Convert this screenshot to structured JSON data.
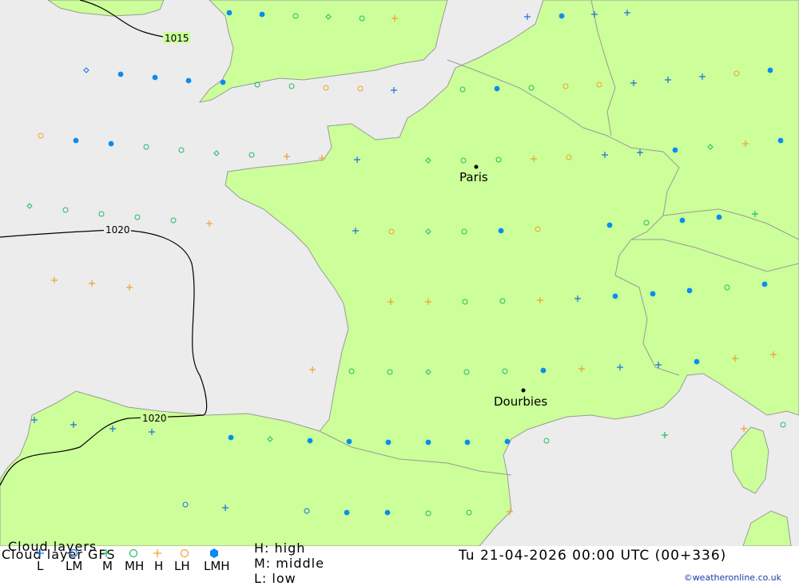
{
  "colors": {
    "sea": "#ececec",
    "land": "#ccff99",
    "border": "#9a9a9a",
    "isobar": "#000000",
    "low": "#1a6fe0",
    "middle": "#22bb66",
    "high": "#f0a030",
    "lmh": "#0a8cf0"
  },
  "isobars": [
    {
      "label": "1015"
    },
    {
      "label": "1020"
    },
    {
      "label": "1020"
    }
  ],
  "cities": [
    {
      "name": "Paris"
    },
    {
      "name": "Dourbies"
    }
  ],
  "footer": {
    "title_top": "Cloud layers",
    "title": "Cloud layer   GFS",
    "legend": [
      {
        "label": "L",
        "icon": "plus",
        "color": "#1a6fe0"
      },
      {
        "label": "LM",
        "icon": "circle",
        "color": "#1a6fe0"
      },
      {
        "label": "M",
        "icon": "plus",
        "color": "#22bb66"
      },
      {
        "label": "MH",
        "icon": "circle",
        "color": "#22bb66"
      },
      {
        "label": "H",
        "icon": "plus",
        "color": "#f0a030"
      },
      {
        "label": "LH",
        "icon": "circle",
        "color": "#f0a030"
      },
      {
        "label": "LMH",
        "icon": "hexagon",
        "color": "#0a8cf0"
      }
    ],
    "key_high": "H: high",
    "key_middle": "M: middle",
    "key_low": "L: low",
    "datetime": "Tu 21-04-2026 00:00 UTC (00+336)",
    "credit": "©weatheronline.co.uk"
  }
}
